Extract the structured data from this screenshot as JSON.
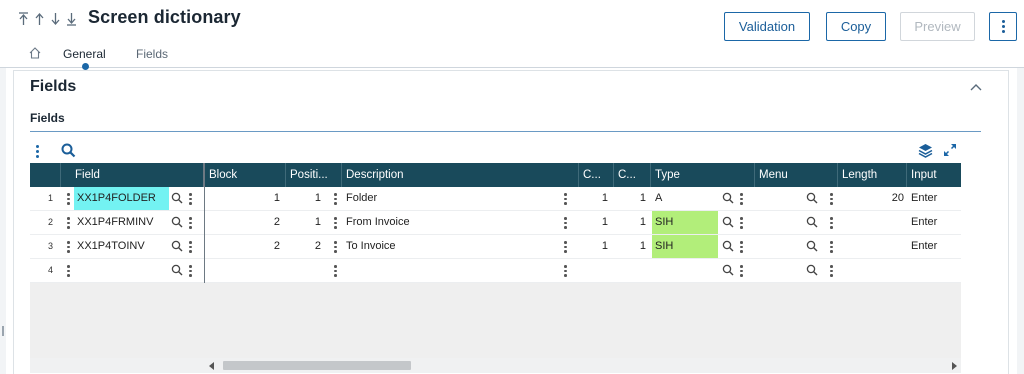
{
  "header": {
    "title": "Screen dictionary",
    "nav_icons": [
      "first-record-icon",
      "previous-record-icon",
      "next-record-icon",
      "last-record-icon"
    ],
    "buttons": {
      "validation": "Validation",
      "copy": "Copy",
      "preview": "Preview"
    }
  },
  "tabs": {
    "home_icon": "home-icon",
    "general": "General",
    "fields": "Fields",
    "active": "General"
  },
  "section": {
    "title": "Fields",
    "subtitle": "Fields"
  },
  "grid": {
    "columns": [
      "Field",
      "Block",
      "Positi...",
      "Description",
      "C...",
      "C...",
      "Type",
      "Menu",
      "Length",
      "Input"
    ],
    "rows": [
      {
        "n": "1",
        "field": "XX1P4FOLDER",
        "block": "1",
        "position": "1",
        "description": "Folder",
        "c1": "1",
        "c2": "1",
        "type": "A",
        "menu": "",
        "length": "20",
        "input": "Enter"
      },
      {
        "n": "2",
        "field": "XX1P4FRMINV",
        "block": "2",
        "position": "1",
        "description": "From Invoice",
        "c1": "1",
        "c2": "1",
        "type": "SIH",
        "menu": "",
        "length": "",
        "input": "Enter"
      },
      {
        "n": "3",
        "field": "XX1P4TOINV",
        "block": "2",
        "position": "2",
        "description": "To Invoice",
        "c1": "1",
        "c2": "1",
        "type": "SIH",
        "menu": "",
        "length": "",
        "input": "Enter"
      },
      {
        "n": "4",
        "field": "",
        "block": "",
        "position": "",
        "description": "",
        "c1": "",
        "c2": "",
        "type": "",
        "menu": "",
        "length": "",
        "input": ""
      }
    ]
  },
  "colors": {
    "header_bg": "#194a5b",
    "accent": "#1b67a7",
    "highlight_field": "#73f2f2",
    "highlight_type": "#b2ee7a"
  }
}
